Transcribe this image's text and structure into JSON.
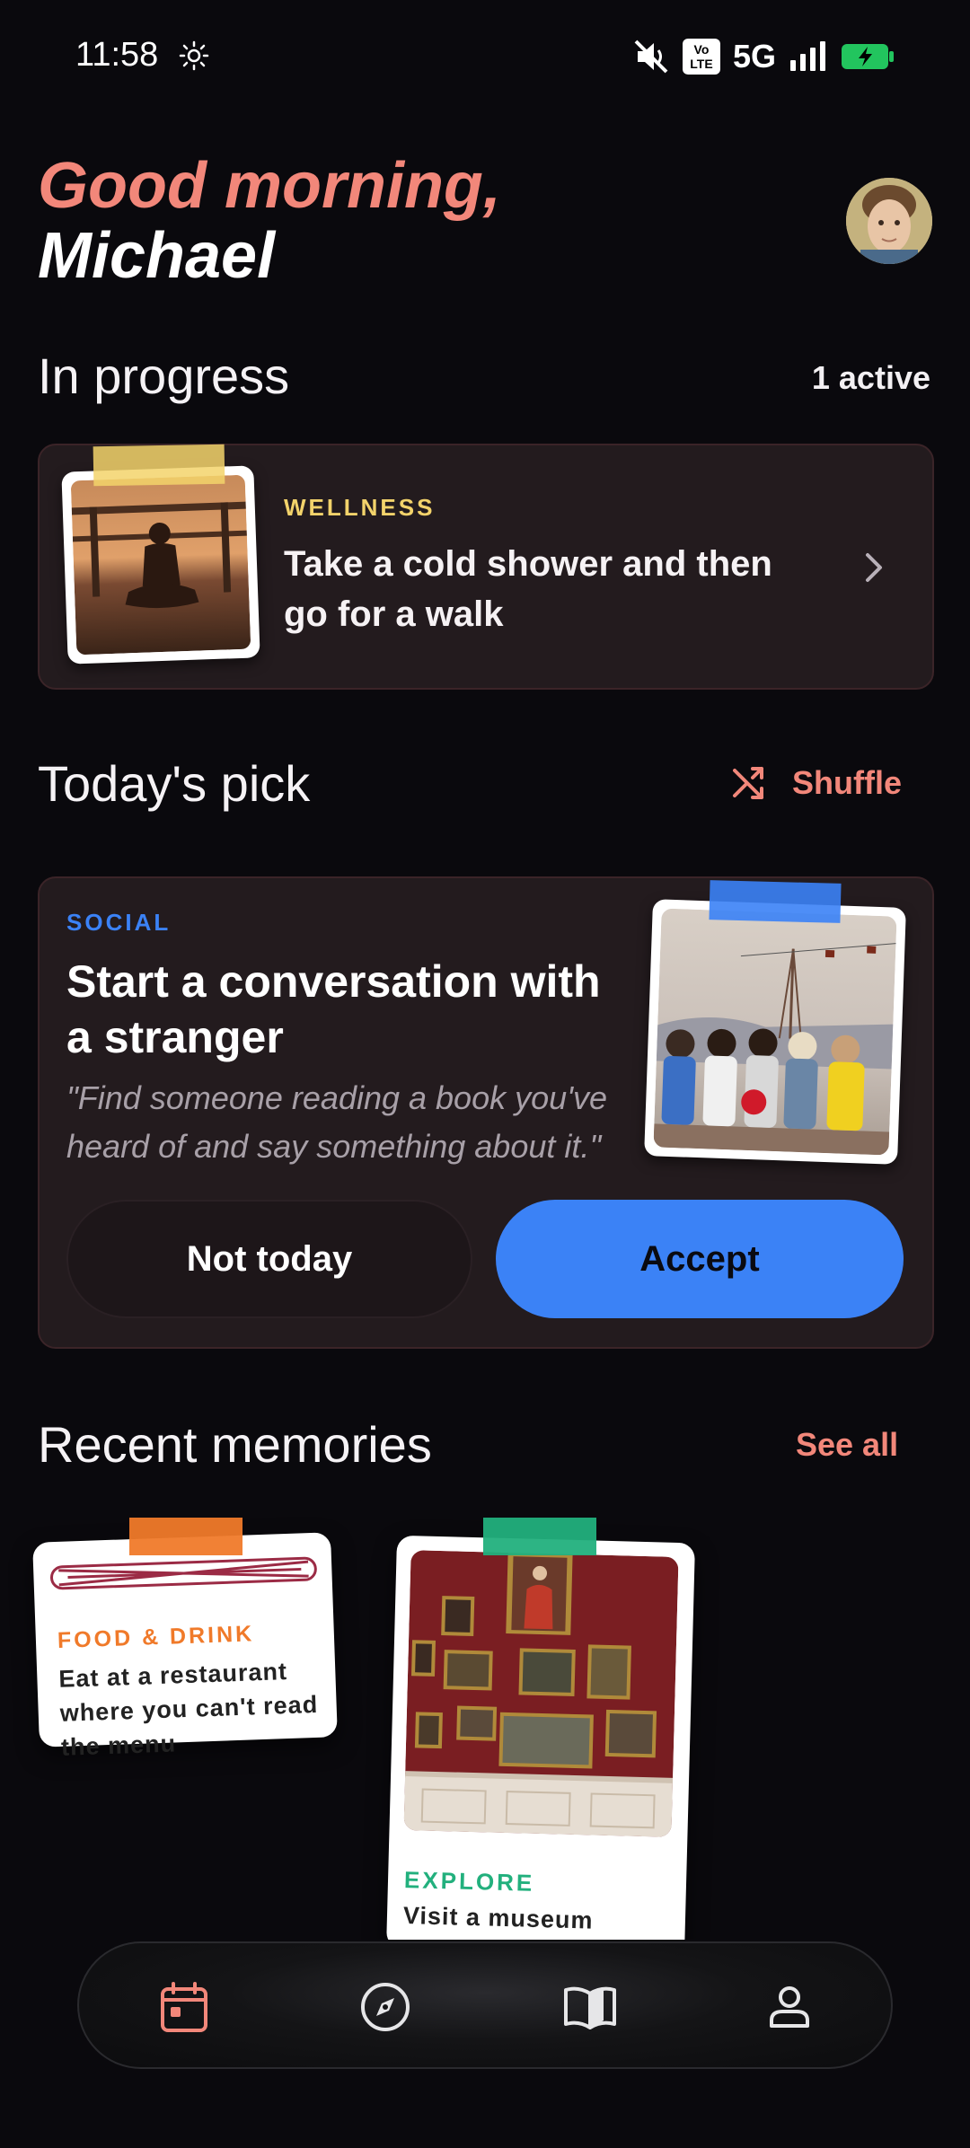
{
  "status_bar": {
    "time": "11:58",
    "network": "5G",
    "volte": "Vo LTE"
  },
  "greeting": {
    "line1": "Good morning,",
    "line2": "Michael"
  },
  "in_progress": {
    "title": "In progress",
    "count_label": "1 active",
    "card": {
      "category": "WELLNESS",
      "title": "Take a cold shower and then go for a walk"
    }
  },
  "todays_pick": {
    "title": "Today's pick",
    "shuffle_label": "Shuffle",
    "card": {
      "category": "SOCIAL",
      "title": "Start a conversation with a stranger",
      "quote": "\"Find someone reading a book you've heard of and say something about it.\"",
      "decline_label": "Not today",
      "accept_label": "Accept"
    }
  },
  "recent_memories": {
    "title": "Recent memories",
    "see_all_label": "See all",
    "items": [
      {
        "category": "FOOD & DRINK",
        "title": "Eat at a restaurant where you can't read the menu"
      },
      {
        "category": "EXPLORE",
        "title": "Visit a museum"
      }
    ]
  },
  "nav": {
    "items": [
      "calendar-icon",
      "compass-icon",
      "book-icon",
      "profile-icon"
    ],
    "active": "calendar-icon"
  },
  "colors": {
    "accent_coral": "#f2877a",
    "wellness": "#f3d36b",
    "social": "#3b82f6",
    "food": "#f07a2a",
    "explore": "#22b07d"
  }
}
